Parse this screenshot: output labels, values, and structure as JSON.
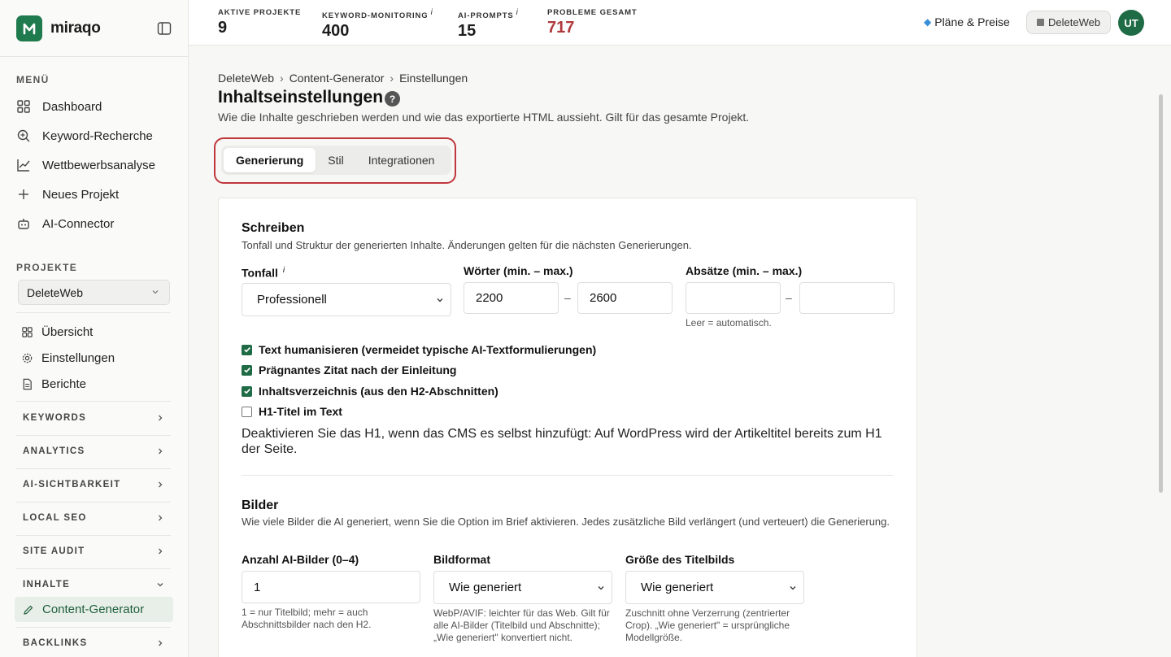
{
  "app": {
    "logo_text": "miraqo"
  },
  "sidebar": {
    "menu_label": "MENÜ",
    "menu_items": [
      {
        "label": "Dashboard",
        "icon": "grid-icon"
      },
      {
        "label": "Keyword-Recherche",
        "icon": "search-icon"
      },
      {
        "label": "Wettbewerbsanalyse",
        "icon": "chart-line-icon"
      },
      {
        "label": "Neues Projekt",
        "icon": "plus-icon"
      },
      {
        "label": "AI-Connector",
        "icon": "robot-icon"
      }
    ],
    "projects_label": "PROJEKTE",
    "project_selected": "DeleteWeb",
    "project_items": [
      {
        "label": "Übersicht",
        "icon": "grid-icon"
      },
      {
        "label": "Einstellungen",
        "icon": "gear-icon"
      },
      {
        "label": "Berichte",
        "icon": "document-icon"
      }
    ],
    "groups": [
      {
        "label": "KEYWORDS"
      },
      {
        "label": "ANALYTICS"
      },
      {
        "label": "AI-SICHTBARKEIT"
      },
      {
        "label": "LOCAL SEO"
      },
      {
        "label": "SITE AUDIT"
      },
      {
        "label": "INHALTE"
      },
      {
        "label": "BACKLINKS"
      }
    ],
    "active_item": "Content-Generator"
  },
  "topbar": {
    "stats": [
      {
        "label": "AKTIVE PROJEKTE",
        "info": "",
        "value": "9"
      },
      {
        "label": "KEYWORD-MONITORING",
        "info": "i",
        "value": "400"
      },
      {
        "label": "AI-PROMPTS",
        "info": "i",
        "value": "15"
      },
      {
        "label": "PROBLEME GESAMT",
        "info": "",
        "value": "717"
      }
    ],
    "plans_label": "Pläne & Preise",
    "project_pill": "DeleteWeb",
    "avatar_initials": "UT"
  },
  "page": {
    "breadcrumb": [
      "DeleteWeb",
      "Content-Generator",
      "Einstellungen"
    ],
    "breadcrumb_sep": "›",
    "title": "Inhaltseinstellungen",
    "help": "?",
    "subtitle": "Wie die Inhalte geschrieben werden und wie das exportierte HTML aussieht. Gilt für das gesamte Projekt.",
    "tabs": [
      "Generierung",
      "Stil",
      "Integrationen"
    ],
    "active_tab": "Generierung"
  },
  "writing": {
    "heading": "Schreiben",
    "description": "Tonfall und Struktur der generierten Inhalte. Änderungen gelten für die nächsten Generierungen.",
    "tone_label": "Tonfall",
    "tone_info": "i",
    "tone_value": "Professionell",
    "words_label": "Wörter (min. – max.)",
    "words_min": "2200",
    "words_max": "2600",
    "paragraphs_label": "Absätze (min. – max.)",
    "paragraphs_min": "",
    "paragraphs_max": "",
    "range_sep": "–",
    "paragraphs_hint": "Leer = automatisch.",
    "checkboxes": [
      {
        "label": "Text humanisieren (vermeidet typische AI-Textformulierungen)",
        "checked": true
      },
      {
        "label": "Prägnantes Zitat nach der Einleitung",
        "checked": true
      },
      {
        "label": "Inhaltsverzeichnis (aus den H2-Abschnitten)",
        "checked": true
      },
      {
        "label": "H1-Titel im Text",
        "checked": false
      }
    ],
    "h1_note": "Deaktivieren Sie das H1, wenn das CMS es selbst hinzufügt: Auf WordPress wird der Artikeltitel bereits zum H1 der Seite."
  },
  "images": {
    "heading": "Bilder",
    "description": "Wie viele Bilder die AI generiert, wenn Sie die Option im Brief aktivieren. Jedes zusätzliche Bild verlängert (und verteuert) die Generierung.",
    "count_label": "Anzahl AI-Bilder (0–4)",
    "count_value": "1",
    "count_hint": "1 = nur Titelbild; mehr = auch Abschnittsbilder nach den H2.",
    "format_label": "Bildformat",
    "format_value": "Wie generiert",
    "format_hint": "WebP/AVIF: leichter für das Web. Gilt für alle AI-Bilder (Titelbild und Abschnitte); „Wie generiert\" konvertiert nicht.",
    "size_label": "Größe des Titelbilds",
    "size_value": "Wie generiert",
    "size_hint": "Zuschnitt ohne Verzerrung (zentrierter Crop). „Wie generiert\" = ursprüngliche Modellgröße."
  },
  "colors": {
    "brand": "#1f7a4d",
    "alert": "#b0383a",
    "highlight": "#c0373b"
  }
}
